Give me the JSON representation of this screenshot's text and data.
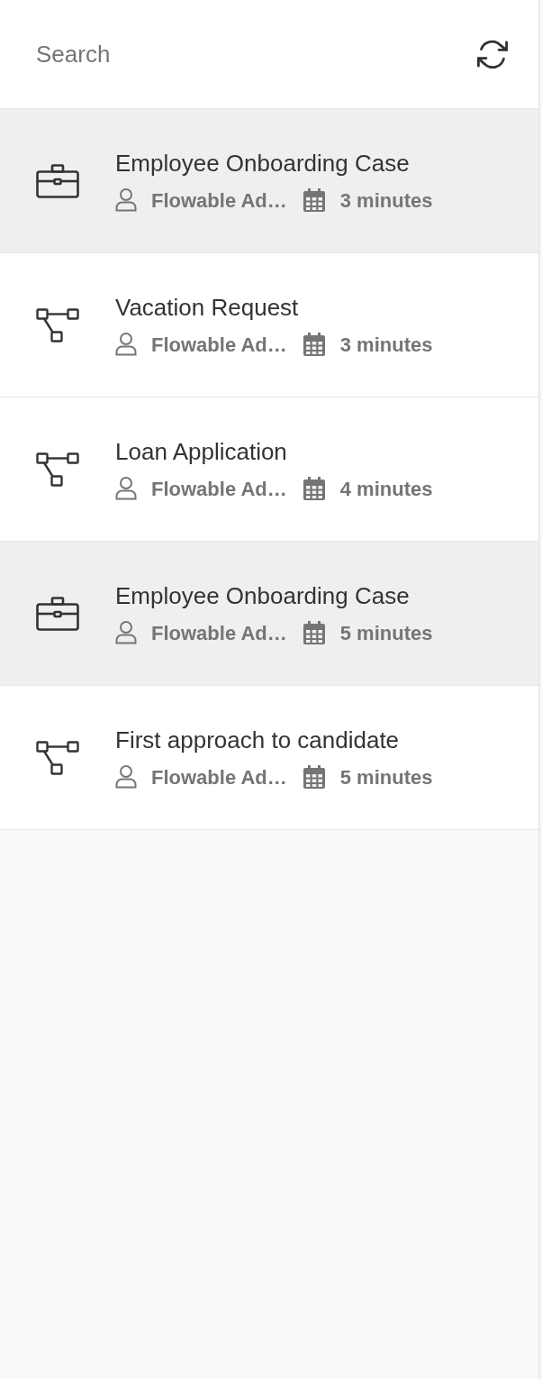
{
  "search": {
    "placeholder": "Search"
  },
  "items": [
    {
      "kind": "case",
      "title": "Employee Onboarding Case",
      "user": "Flowable Ad…",
      "time": "3 minutes",
      "selected": true
    },
    {
      "kind": "process",
      "title": "Vacation Request",
      "user": "Flowable Ad…",
      "time": "3 minutes",
      "selected": false
    },
    {
      "kind": "process",
      "title": "Loan Application",
      "user": "Flowable Ad…",
      "time": "4 minutes",
      "selected": false
    },
    {
      "kind": "case",
      "title": "Employee Onboarding Case",
      "user": "Flowable Ad…",
      "time": "5 minutes",
      "selected": true
    },
    {
      "kind": "process",
      "title": "First approach to candidate",
      "user": "Flowable Ad…",
      "time": "5 minutes",
      "selected": false
    }
  ]
}
